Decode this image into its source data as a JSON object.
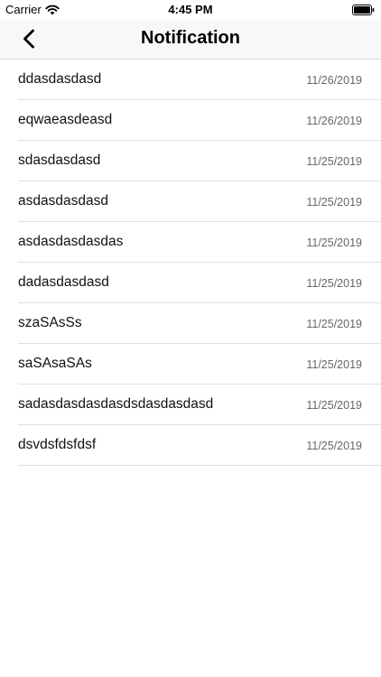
{
  "status_bar": {
    "carrier": "Carrier",
    "time": "4:45 PM",
    "icons": [
      "wifi-icon",
      "battery-icon"
    ]
  },
  "nav": {
    "title": "Notification",
    "back_icon": "chevron-left-icon"
  },
  "notifications": [
    {
      "message": "ddasdasdasd",
      "date": "11/26/2019"
    },
    {
      "message": "eqwaeasdeasd",
      "date": "11/26/2019"
    },
    {
      "message": "sdasdasdasd",
      "date": "11/25/2019"
    },
    {
      "message": "asdasdasdasd",
      "date": "11/25/2019"
    },
    {
      "message": "asdasdasdasdas",
      "date": "11/25/2019"
    },
    {
      "message": "dadasdasdasd",
      "date": "11/25/2019"
    },
    {
      "message": "szaSAsSs",
      "date": "11/25/2019"
    },
    {
      "message": "saSAsaSAs",
      "date": "11/25/2019"
    },
    {
      "message": "sadasdasdasdasdsdasdasdasd",
      "date": "11/25/2019"
    },
    {
      "message": "dsvdsfdsfdsf",
      "date": "11/25/2019"
    }
  ]
}
